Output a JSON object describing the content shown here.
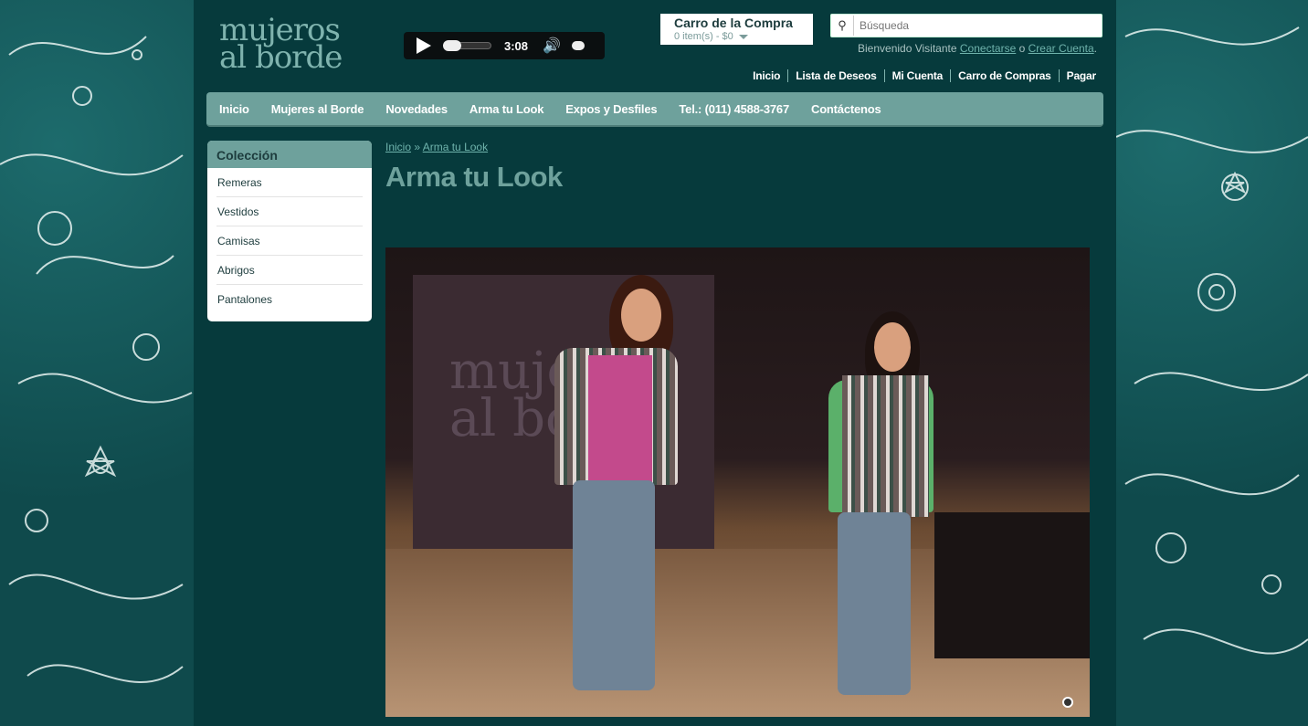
{
  "header": {
    "logo_line1": "mujeros",
    "logo_line2": "al borde",
    "player": {
      "time": "3:08"
    },
    "cart": {
      "title": "Carro de la Compra",
      "items": "0 item(s) - $0"
    },
    "search": {
      "placeholder": "Búsqueda"
    },
    "welcome": {
      "text": "Bienvenido Visitante",
      "login": "Conectarse",
      "or": "o",
      "register": "Crear Cuenta",
      "end": "."
    },
    "top_links": [
      "Inicio",
      "Lista de Deseos",
      "Mi Cuenta",
      "Carro de Compras",
      "Pagar"
    ]
  },
  "nav": [
    "Inicio",
    "Mujeres al Borde",
    "Novedades",
    "Arma tu Look",
    "Expos y Desfiles",
    "Tel.: (011) 4588-3767",
    "Contáctenos"
  ],
  "sidebar": {
    "title": "Colección",
    "items": [
      "Remeras",
      "Vestidos",
      "Camisas",
      "Abrigos",
      "Pantalones"
    ]
  },
  "breadcrumb": {
    "home": "Inicio",
    "sep": "»",
    "current": "Arma tu Look"
  },
  "main": {
    "title": "Arma tu Look",
    "photo_backdrop_line1": "mujeres",
    "photo_backdrop_line2": "al borde"
  },
  "colors": {
    "accent": "#6ea19c",
    "page_bg": "#063a3c",
    "outer_bg": "#0f4a4c"
  }
}
